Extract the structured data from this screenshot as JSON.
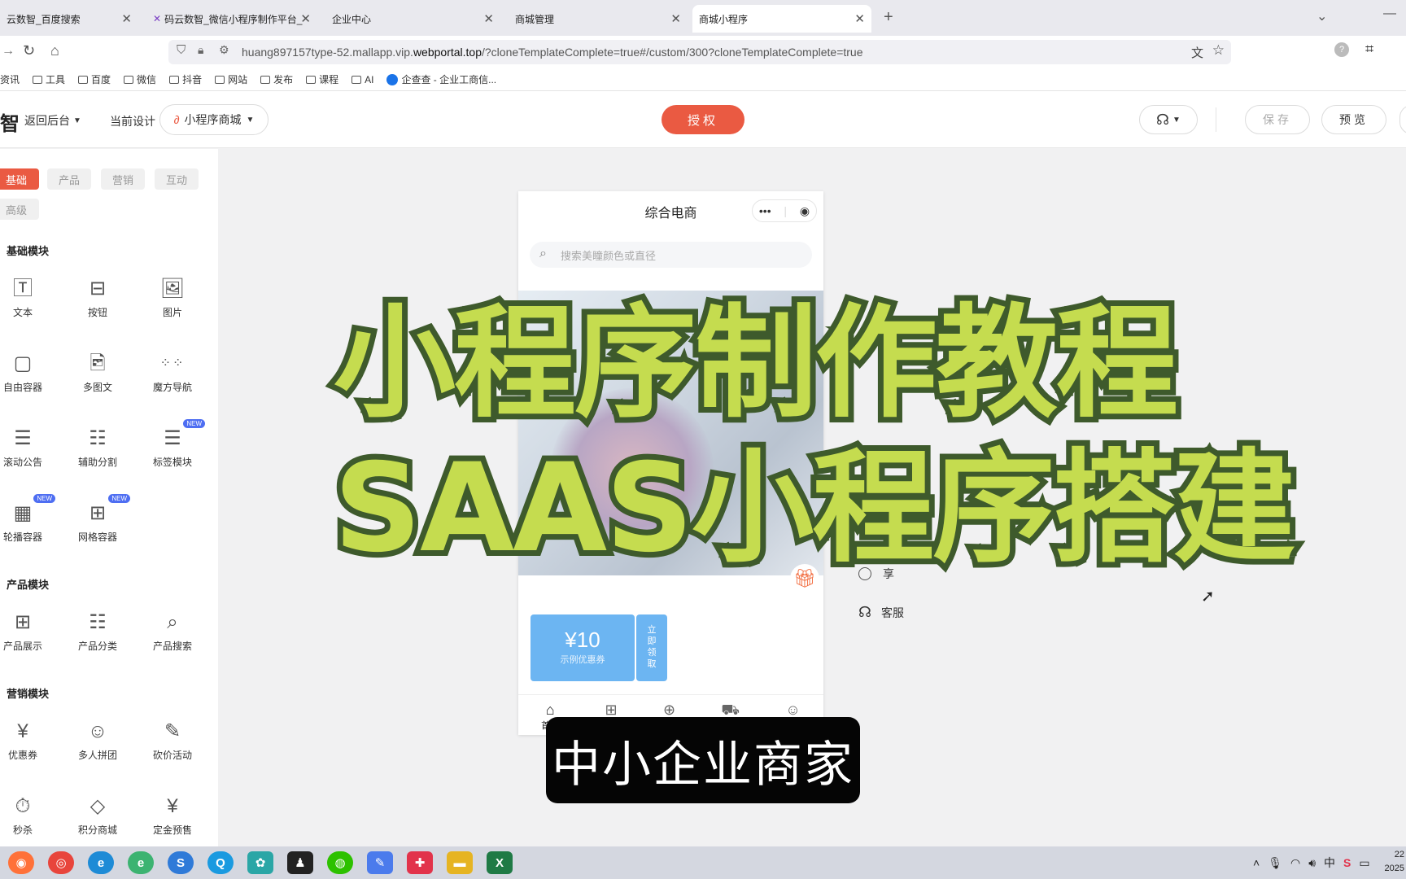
{
  "browser": {
    "tabs": [
      {
        "title": "云数智_百度搜索",
        "active": false
      },
      {
        "title": "码云数智_微信小程序制作平台_",
        "active": false
      },
      {
        "title": "企业中心",
        "active": false
      },
      {
        "title": "商城管理",
        "active": false
      },
      {
        "title": "商城小程序",
        "active": true
      }
    ],
    "url_host": "huang897157type-52.mallapp.vip.",
    "url_domain": "webportal.top",
    "url_path": "/?cloneTemplateComplete=true#/custom/300?cloneTemplateComplete=true",
    "bookmarks": [
      "资讯",
      "工具",
      "百度",
      "微信",
      "抖音",
      "网站",
      "发布",
      "课程",
      "AI",
      "企查查 - 企业工商信..."
    ]
  },
  "header": {
    "logo_char": "智",
    "back_label": "返回后台",
    "current_design_label": "当前设计",
    "design_select": "小程序商城",
    "auth_label": "授权",
    "save_label": "保存",
    "preview_label": "预览"
  },
  "sidebar": {
    "tabs": [
      "基础",
      "产品",
      "营销",
      "互动",
      "高级"
    ],
    "sections": [
      {
        "title": "基础模块",
        "items": [
          {
            "label": "文本",
            "icon": "text-icon"
          },
          {
            "label": "按钮",
            "icon": "button-icon"
          },
          {
            "label": "图片",
            "icon": "image-icon"
          },
          {
            "label": "自由容器",
            "icon": "free-container-icon"
          },
          {
            "label": "多图文",
            "icon": "multi-image-icon"
          },
          {
            "label": "魔方导航",
            "icon": "grid-dots-icon"
          },
          {
            "label": "滚动公告",
            "icon": "notice-icon"
          },
          {
            "label": "辅助分割",
            "icon": "divider-icon"
          },
          {
            "label": "标签模块",
            "icon": "tag-list-icon",
            "badge": "NEW"
          },
          {
            "label": "轮播容器",
            "icon": "carousel-icon",
            "badge": "NEW"
          },
          {
            "label": "网格容器",
            "icon": "grid-container-icon",
            "badge": "NEW"
          }
        ]
      },
      {
        "title": "产品模块",
        "items": [
          {
            "label": "产品展示",
            "icon": "product-grid-icon"
          },
          {
            "label": "产品分类",
            "icon": "product-list-icon"
          },
          {
            "label": "产品搜索",
            "icon": "product-search-icon"
          }
        ]
      },
      {
        "title": "营销模块",
        "items": [
          {
            "label": "优惠券",
            "icon": "coupon-icon"
          },
          {
            "label": "多人拼团",
            "icon": "group-buy-icon"
          },
          {
            "label": "砍价活动",
            "icon": "bargain-icon"
          },
          {
            "label": "秒杀",
            "icon": "flash-sale-icon"
          },
          {
            "label": "积分商城",
            "icon": "points-icon"
          },
          {
            "label": "定金预售",
            "icon": "presale-icon"
          }
        ]
      }
    ]
  },
  "phone": {
    "title": "综合电商",
    "search_placeholder": "搜索美瞳颜色或直径",
    "coupon_amount": "¥10",
    "coupon_note": "示例优惠券",
    "coupon_action": "立即领取",
    "tab_home": "首页"
  },
  "side_menu": [
    "享",
    "客服"
  ],
  "overlay": {
    "line1": "小程序制作教程",
    "line2": "SAAS小程序搭建",
    "caption": "中小企业商家"
  },
  "taskbar": {
    "ime": "中",
    "clock_time": "22",
    "clock_year": "2025"
  },
  "colors": {
    "accent": "#ea5a42",
    "overlay_fill": "#c5dc4f",
    "overlay_stroke": "#3e5a2c",
    "coupon_blue": "#6cb5f2"
  }
}
